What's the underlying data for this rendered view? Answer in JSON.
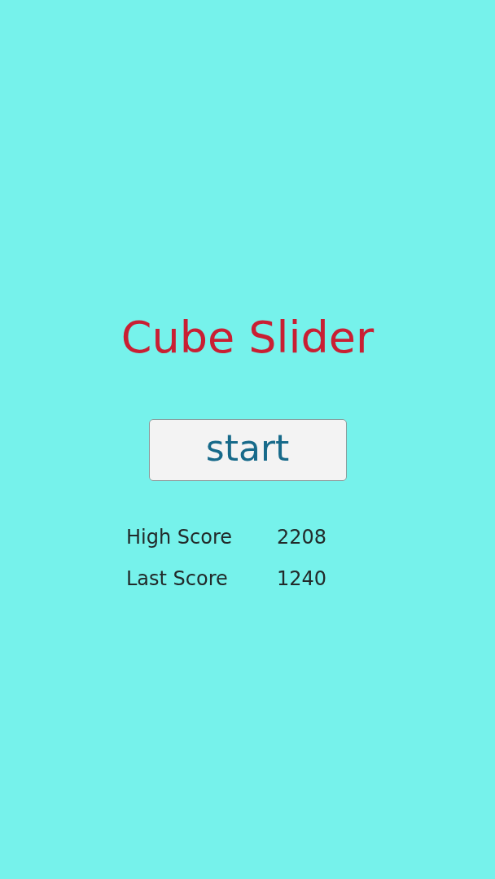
{
  "title": "Cube Slider",
  "start_button": {
    "label": "start"
  },
  "scores": [
    {
      "label": "High Score",
      "value": "2208"
    },
    {
      "label": "Last Score",
      "value": "1240"
    }
  ]
}
